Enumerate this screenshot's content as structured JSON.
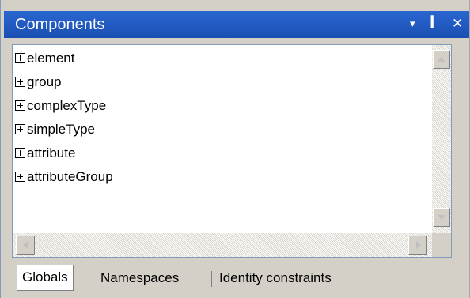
{
  "panel": {
    "title": "Components",
    "buttons": {
      "menu_glyph": "▾",
      "pin_glyph": "ꟾ",
      "close_glyph": "✕"
    }
  },
  "tree": {
    "items": [
      {
        "label": "element"
      },
      {
        "label": "group"
      },
      {
        "label": "complexType"
      },
      {
        "label": "simpleType"
      },
      {
        "label": "attribute"
      },
      {
        "label": "attributeGroup"
      }
    ]
  },
  "tabs": [
    {
      "label": "Globals",
      "active": true
    },
    {
      "label": "Namespaces",
      "active": false
    },
    {
      "label": "Identity constraints",
      "active": false
    }
  ],
  "colors": {
    "titlebar": "#1a4fb2",
    "panel_bg": "#d4d0c8",
    "content_bg": "#ffffff"
  }
}
